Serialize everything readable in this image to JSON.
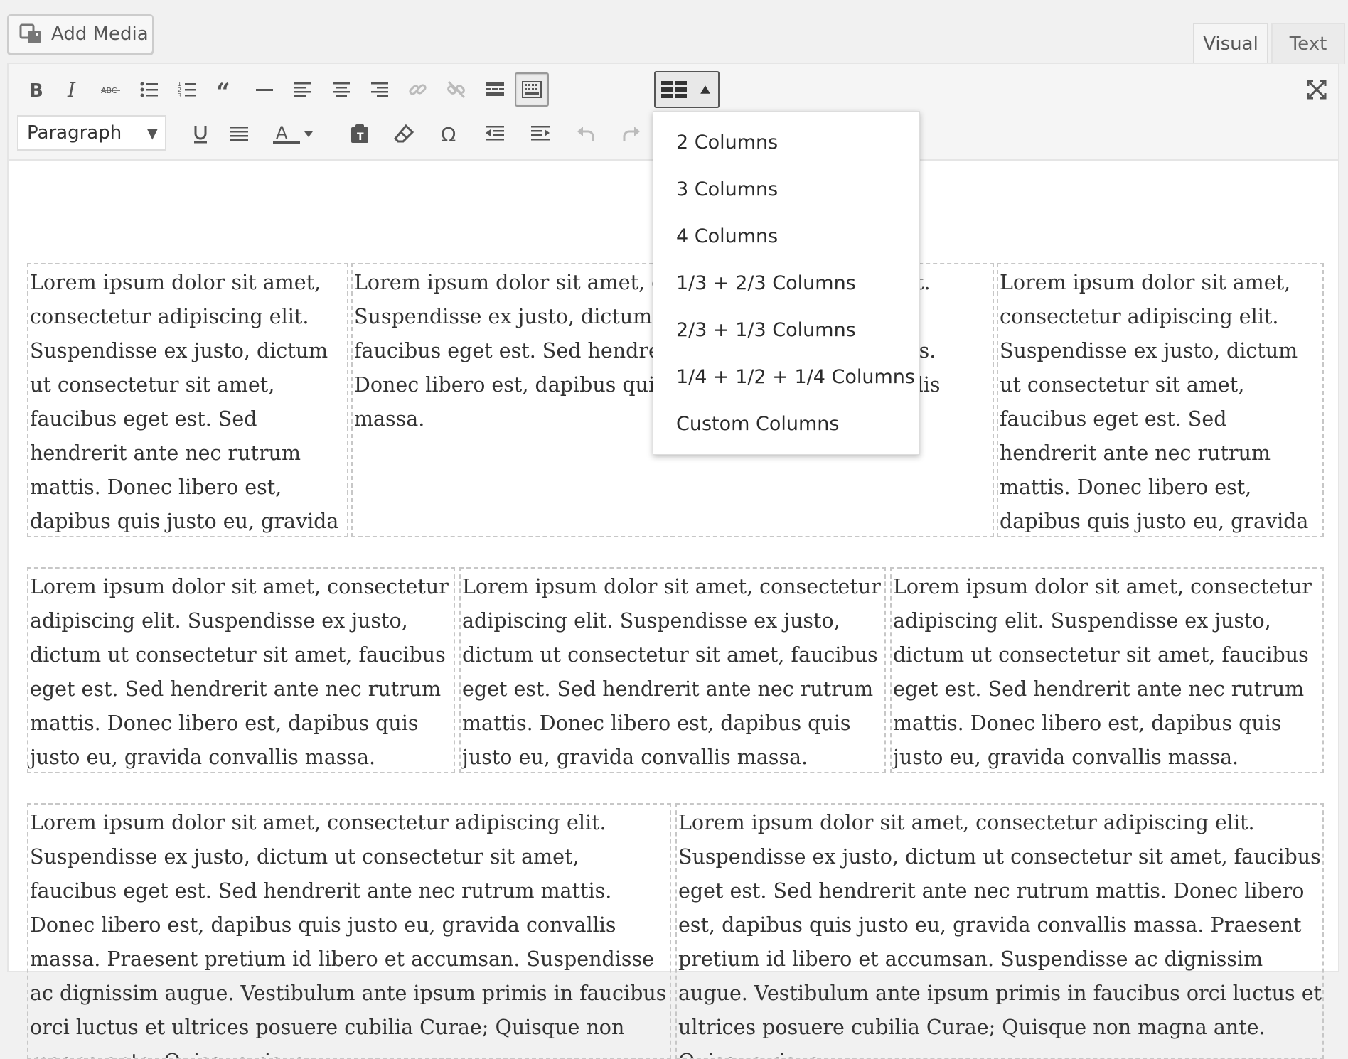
{
  "header": {
    "add_media_label": "Add Media",
    "tabs": [
      {
        "label": "Visual"
      },
      {
        "label": "Text"
      }
    ]
  },
  "toolbar": {
    "format_select_value": "Paragraph",
    "row1_icons": [
      "bold-icon",
      "italic-icon",
      "strikethrough-icon",
      "bullet-list-icon",
      "numbered-list-icon",
      "blockquote-icon",
      "horizontal-line-icon",
      "align-left-icon",
      "align-center-icon",
      "align-right-icon",
      "insert-link-icon",
      "remove-link-icon",
      "read-more-icon",
      "toolbar-toggle-icon",
      "columns-icon",
      "fullscreen-icon"
    ],
    "row2_icons": [
      "underline-icon",
      "justify-icon",
      "text-color-icon",
      "paste-as-text-icon",
      "clear-formatting-icon",
      "special-character-icon",
      "decrease-indent-icon",
      "increase-indent-icon",
      "undo-icon",
      "redo-icon"
    ]
  },
  "columns_menu": {
    "items": [
      {
        "label": "2 Columns"
      },
      {
        "label": "3 Columns"
      },
      {
        "label": "4 Columns"
      },
      {
        "label": "1/3 + 2/3 Columns"
      },
      {
        "label": "2/3 + 1/3 Columns"
      },
      {
        "label": "1/4 + 1/2 + 1/4 Columns"
      },
      {
        "label": "Custom Columns"
      }
    ]
  },
  "content": {
    "row1": [
      {
        "text": "Lorem ipsum dolor sit amet, consectetur adipiscing elit. Suspendisse ex justo, dictum ut consectetur sit amet, faucibus eget est. Sed hendrerit ante nec rutrum mattis. Donec libero est, dapibus quis justo eu, gravida convallis massa."
      },
      {
        "text": "Lorem ipsum dolor sit amet, consectetur adipiscing elit. Suspendisse ex justo, dictum ut consectetur sit amet, faucibus eget est. Sed hendrerit ante nec rutrum mattis. Donec libero est, dapibus quis justo eu, gravida convallis massa."
      },
      {
        "text": "Lorem ipsum dolor sit amet, consectetur adipiscing elit. Suspendisse ex justo, dictum ut consectetur sit amet, faucibus eget est. Sed hendrerit ante nec rutrum mattis. Donec libero est, dapibus quis justo eu, gravida convallis massa."
      }
    ],
    "row2": [
      {
        "text": "Lorem ipsum dolor sit amet, consectetur adipiscing elit. Suspendisse ex justo, dictum ut consectetur sit amet, faucibus eget est. Sed hendrerit ante nec rutrum mattis. Donec libero est, dapibus quis justo eu, gravida convallis massa."
      },
      {
        "text": "Lorem ipsum dolor sit amet, consectetur adipiscing elit. Suspendisse ex justo, dictum ut consectetur sit amet, faucibus eget est. Sed hendrerit ante nec rutrum mattis. Donec libero est, dapibus quis justo eu, gravida convallis massa."
      },
      {
        "text": "Lorem ipsum dolor sit amet, consectetur adipiscing elit. Suspendisse ex justo, dictum ut consectetur sit amet, faucibus eget est. Sed hendrerit ante nec rutrum mattis. Donec libero est, dapibus quis justo eu, gravida convallis massa."
      }
    ],
    "row3": [
      {
        "text": "Lorem ipsum dolor sit amet, consectetur adipiscing elit. Suspendisse ex justo, dictum ut consectetur sit amet, faucibus eget est. Sed hendrerit ante nec rutrum mattis. Donec libero est, dapibus quis justo eu, gravida convallis massa. Praesent pretium id libero et accumsan. Suspendisse ac dignissim augue. Vestibulum ante ipsum primis in faucibus orci luctus et ultrices posuere cubilia Curae; Quisque non magna ante. Quisque risus"
      },
      {
        "text": "Lorem ipsum dolor sit amet, consectetur adipiscing elit. Suspendisse ex justo, dictum ut consectetur sit amet, faucibus eget est. Sed hendrerit ante nec rutrum mattis. Donec libero est, dapibus quis justo eu, gravida convallis massa. Praesent pretium id libero et accumsan. Suspendisse ac dignissim augue. Vestibulum ante ipsum primis in faucibus orci luctus et ultrices posuere cubilia Curae; Quisque non magna ante. Quisque risus"
      }
    ]
  }
}
